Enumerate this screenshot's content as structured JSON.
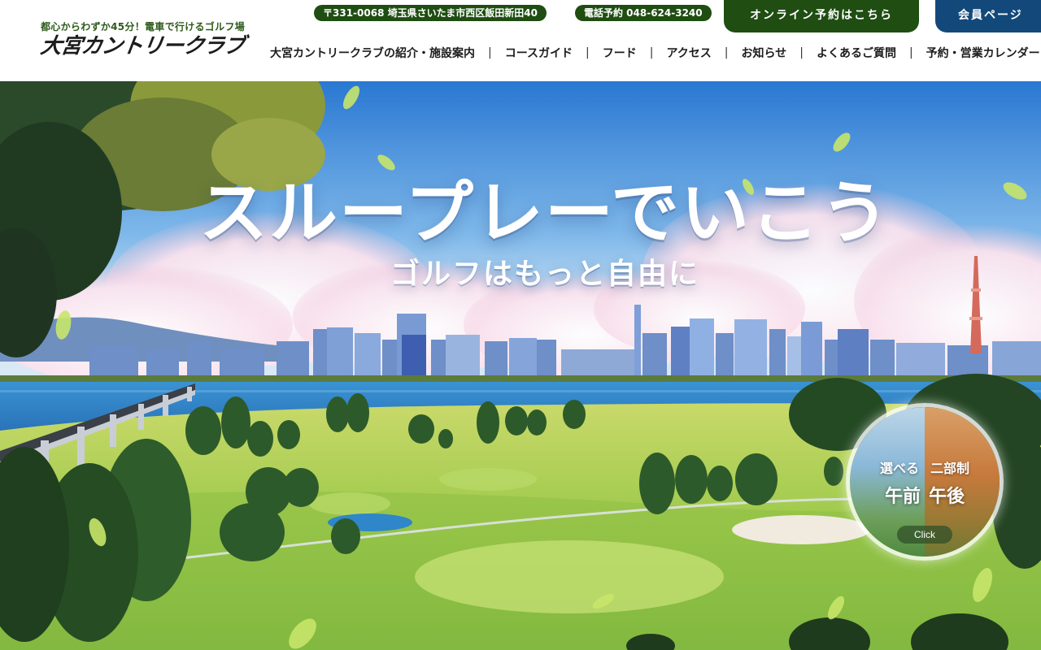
{
  "header": {
    "tagline": "都心からわずか45分！電車で行けるゴルフ場",
    "logo_name": "大宮カントリークラブ",
    "address": "〒331-0068 埼玉県さいたま市西区飯田新田40",
    "phone": "電話予約 048-624-3240",
    "online_booking_label": "オンライン予約はこちら",
    "member_page_label": "会員ページ"
  },
  "nav": {
    "items": [
      "大宮カントリークラブの紹介・施設案内",
      "コースガイド",
      "フード",
      "アクセス",
      "お知らせ",
      "よくあるご質問",
      "予約・営業カレンダー"
    ],
    "separator": "|"
  },
  "hero": {
    "title": "スループレーでいこう",
    "subtitle": "ゴルフはもっと自由に",
    "badge": {
      "line1_left": "選べる",
      "line1_right": "二部制",
      "line2_left": "午前",
      "line2_right": "午後",
      "click_label": "Click"
    }
  },
  "colors": {
    "brand_green": "#1f4d12",
    "member_blue": "#13497a",
    "sky_top": "#2f7fd6",
    "water": "#2f86c9",
    "grass": "#9cc94a"
  }
}
